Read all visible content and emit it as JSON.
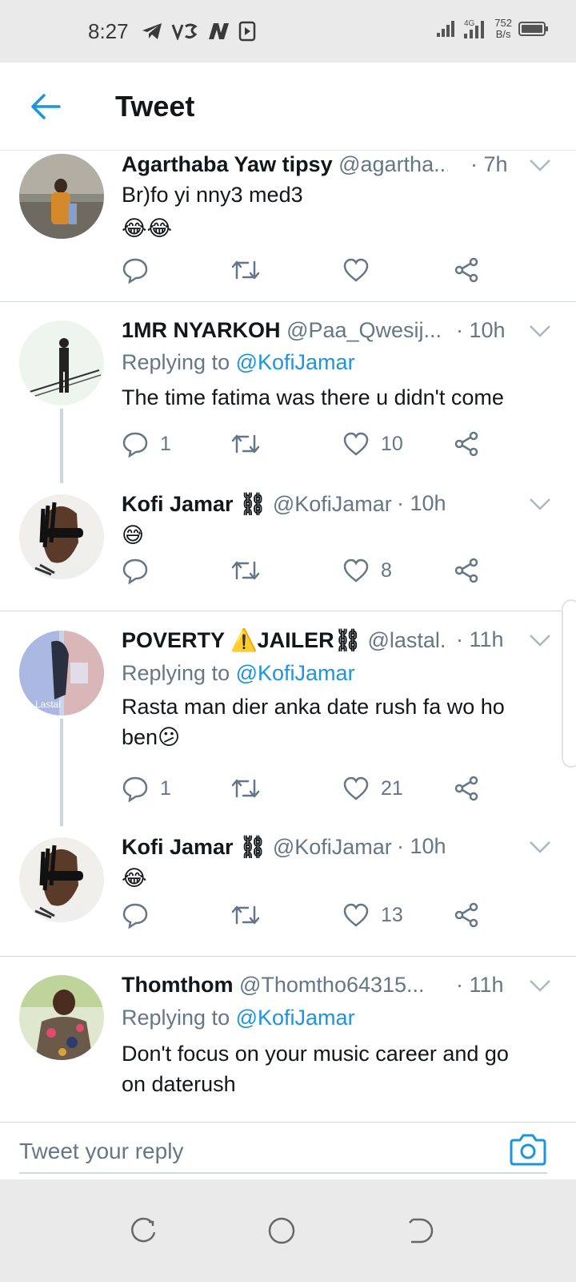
{
  "status_bar": {
    "time": "8:27",
    "net_speed_value": "752",
    "net_speed_unit": "B/s",
    "network_type": "4G"
  },
  "header": {
    "title": "Tweet"
  },
  "tweets": [
    {
      "name": "Agarthaba Yaw tipsy",
      "handle": "@agartha...",
      "time": "· 7h",
      "replying_prefix": "",
      "replying_to": "",
      "text": "Br)fo yi nny3 med3",
      "text_line2": "😂😂",
      "reply_count": "",
      "like_count": ""
    },
    {
      "name": "1MR NYARKOH",
      "handle": "@Paa_Qwesij...",
      "time": "· 10h",
      "replying_prefix": "Replying to",
      "replying_to": "@KofiJamar",
      "text": "The time fatima was there u didn't come",
      "reply_count": "1",
      "like_count": "10"
    },
    {
      "name": "Kofi Jamar ⛓",
      "handle": "@KofiJamar",
      "time": "· 10h",
      "text": "😅",
      "reply_count": "",
      "like_count": "8"
    },
    {
      "name": "POVERTY ⚠️JAILER⛓",
      "handle": "@lastal...",
      "time": "· 11h",
      "replying_prefix": "Replying to",
      "replying_to": "@KofiJamar",
      "text": "Rasta man dier anka date rush fa wo ho",
      "text_line2": "ben😕",
      "reply_count": "1",
      "like_count": "21"
    },
    {
      "name": "Kofi Jamar ⛓",
      "handle": "@KofiJamar",
      "time": "· 10h",
      "text": "😂",
      "reply_count": "",
      "like_count": "13"
    },
    {
      "name": "Thomthom",
      "handle": "@Thomtho64315...",
      "time": "· 11h",
      "replying_prefix": "Replying to",
      "replying_to": "@KofiJamar",
      "text": "Don't focus on your music career and go",
      "text_line2": "on daterush"
    }
  ],
  "reply_bar": {
    "placeholder": "Tweet your reply"
  },
  "colors": {
    "accent": "#1b95e0",
    "text_primary": "#14171a",
    "text_secondary": "#657786",
    "divider": "#ccd6dd"
  },
  "icons": {
    "back": "arrow-left-icon",
    "reply": "speech-bubble-icon",
    "retweet": "retweet-icon",
    "like": "heart-icon",
    "share": "share-icon",
    "more": "chevron-down-icon",
    "camera": "camera-icon"
  }
}
